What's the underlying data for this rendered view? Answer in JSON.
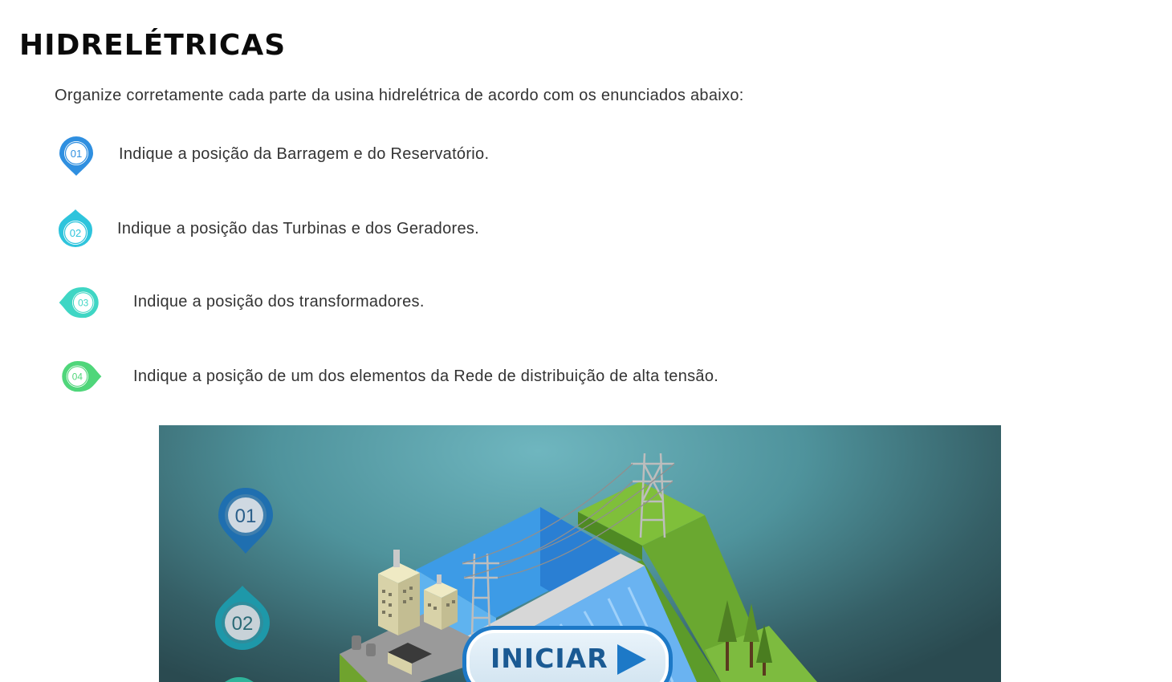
{
  "page": {
    "title": "HIDRELÉTRICAS",
    "intro": "Organize corretamente cada parte da usina hidrelétrica de acordo com os enunciados abaixo:"
  },
  "steps": [
    {
      "number": "01",
      "text": "Indique a posição da Barragem e do Reservatório.",
      "color": "#2f8fe0"
    },
    {
      "number": "02",
      "text": "Indique a posição das Turbinas e dos Geradores.",
      "color": "#2ec4dc"
    },
    {
      "number": "03",
      "text": "Indique a posição dos transformadores.",
      "color": "#3fd6c4"
    },
    {
      "number": "04",
      "text": "Indique a posição de um dos elementos da Rede de distribuição de alta tensão.",
      "color": "#4fd67a"
    }
  ],
  "game": {
    "markers": [
      "01",
      "02"
    ],
    "start_label": "INICIAR",
    "start_color": "#1d79c7"
  }
}
